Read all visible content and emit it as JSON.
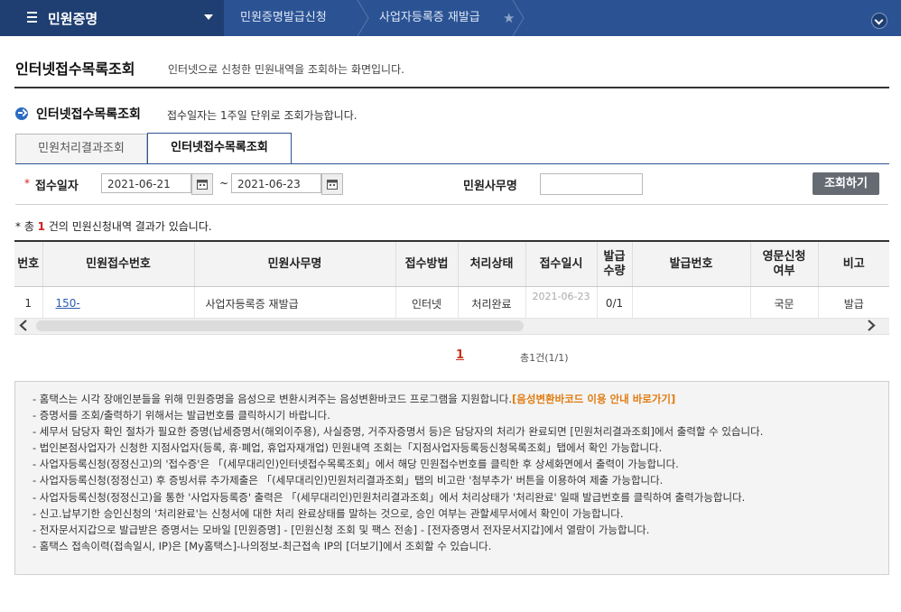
{
  "topbar": {
    "menu_title": "민원증명",
    "crumb1": "민원증명발급신청",
    "crumb2": "사업자등록증 재발급"
  },
  "header": {
    "title": "인터넷접수목록조회",
    "description": "인터넷으로 신청한 민원내역을 조회하는 화면입니다."
  },
  "section": {
    "title": "인터넷접수목록조회",
    "note": "접수일자는 1주일 단위로 조회가능합니다."
  },
  "tabs": [
    {
      "label": "민원처리결과조회",
      "active": false
    },
    {
      "label": "인터넷접수목록조회",
      "active": true
    }
  ],
  "search": {
    "date_label": "접수일자",
    "date_from": "2021-06-21",
    "date_to": "2021-06-23",
    "tilde": "~",
    "service_label": "민원사무명",
    "service_value": "",
    "button": "조회하기"
  },
  "result": {
    "prefix": "* 총 ",
    "count": "1",
    "suffix": " 건의 민원신청내역 결과가 있습니다."
  },
  "table": {
    "headers": [
      "번호",
      "민원접수번호",
      "민원사무명",
      "접수방법",
      "처리상태",
      "접수일시",
      "발급\n수량",
      "발급번호",
      "영문신청\n여부",
      "비고"
    ],
    "rows": [
      {
        "no": "1",
        "receipt_no": "150-",
        "service": "사업자등록증 재발급",
        "method": "인터넷",
        "status": "처리완료",
        "date": "2021-06-23",
        "qty": "0/1",
        "issue_no": "",
        "english": "국문",
        "note": "발급"
      }
    ]
  },
  "pager": {
    "current": "1",
    "info": "총1건(1/1)"
  },
  "notes": {
    "items": [
      "- 홈택스는 시각 장애인분들을 위해 민원증명을 음성으로 변환시켜주는 음성변환바코드 프로그램을 지원합니다.",
      "- 증명서를 조회/출력하기 위해서는 발급번호를 클릭하시기 바랍니다.",
      "- 세무서 담당자 확인 절차가 필요한 증명(납세증명서(해외이주용), 사실증명, 거주자증명서 등)은 담당자의 처리가 완료되면 [민원처리결과조회]에서 출력할 수 있습니다.",
      "- 법인본점사업자가 신청한 지점사업자(등록, 휴·폐업, 휴업자재개업) 민원내역 조회는「지점사업자등록등신청목록조회」탭에서 확인 가능합니다.",
      "- 사업자등록신청(정정신고)의 '접수증'은 「(세무대리인)인터넷접수목록조회」에서 해당 민원접수번호를 클릭한 후 상세화면에서 출력이 가능합니다.",
      "- 사업자등록신청(정정신고) 후 증빙서류 추가제출은 「(세무대리인)민원처리결과조회」탭의 비고란 '첨부추가' 버튼을 이용하여 제출 가능합니다.",
      "- 사업자등록신청(정정신고)을 통한 '사업자등록증' 출력은 「(세무대리인)민원처리결과조회」에서 처리상태가 '처리완료' 일때 발급번호를 클릭하여 출력가능합니다.",
      "- 신고.납부기한 승인신청의 '처리완료'는 신청서에 대한 처리 완료상태를 말하는 것으로, 승인 여부는 관할세무서에서 확인이 가능합니다.",
      "- 전자문서지갑으로 발급받은 증명서는 모바일 [민원증명] - [민원신청 조회 및 팩스 전송] - [전자증명서 전자문서지갑]에서 열람이 가능합니다.",
      "- 홈택스 접속이력(접속일시, IP)은 [My홈택스]-나의정보-최근접속 IP의 [더보기]에서 조회할 수 있습니다."
    ],
    "barcode_link": "[음성변환바코드 이용 안내 바로가기]"
  }
}
